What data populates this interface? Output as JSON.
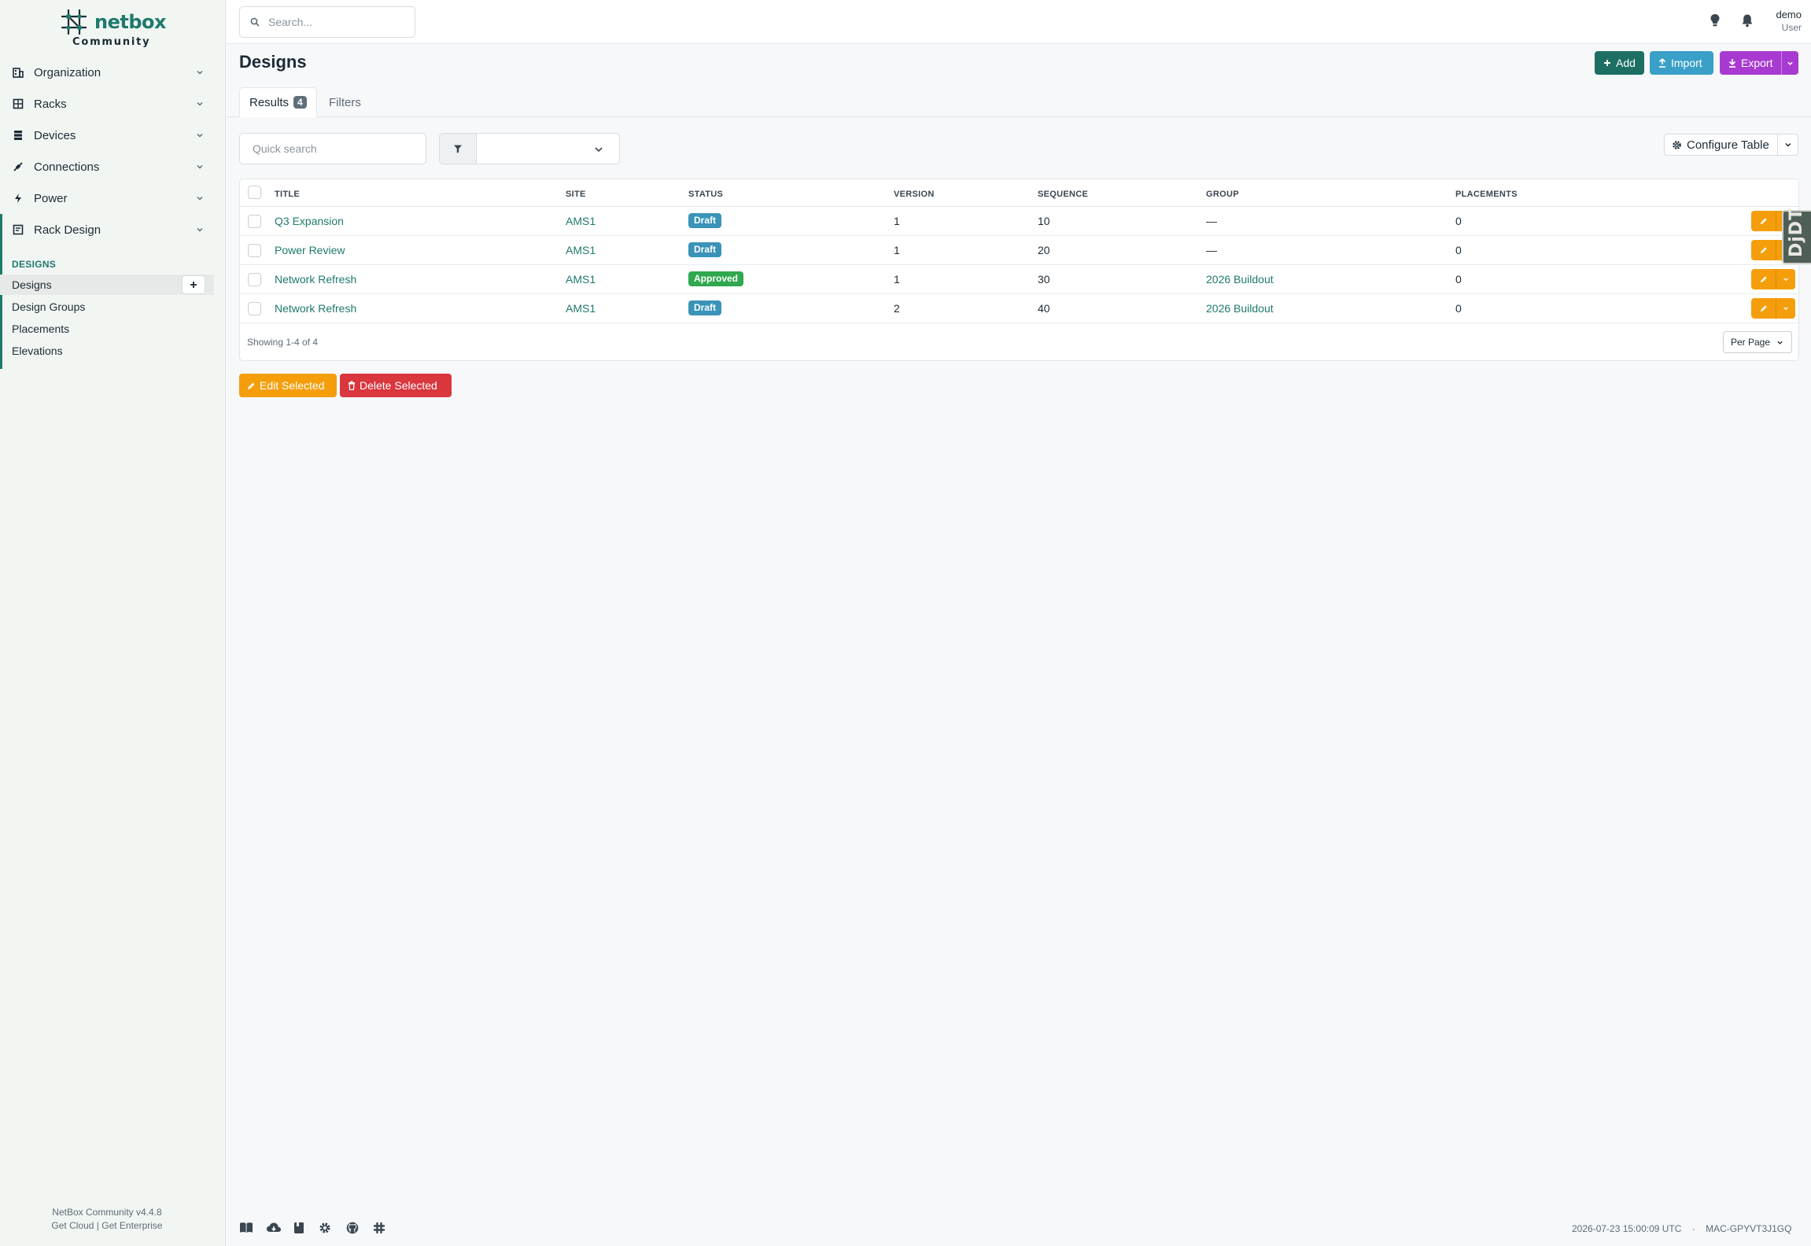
{
  "brand": {
    "name": "netbox",
    "edition": "Community"
  },
  "sidebar": {
    "groups": [
      {
        "label": "Organization",
        "icon": "organization-icon"
      },
      {
        "label": "Racks",
        "icon": "rack-icon"
      },
      {
        "label": "Devices",
        "icon": "devices-icon"
      },
      {
        "label": "Connections",
        "icon": "connections-icon"
      },
      {
        "label": "Power",
        "icon": "power-icon"
      },
      {
        "label": "Rack Design",
        "icon": "rack-design-icon"
      }
    ],
    "section_heading": "DESIGNS",
    "items": [
      {
        "label": "Designs",
        "active": true
      },
      {
        "label": "Design Groups"
      },
      {
        "label": "Placements"
      },
      {
        "label": "Elevations"
      }
    ],
    "footer": {
      "version": "NetBox Community v4.4.8",
      "cloud": "Get Cloud",
      "sep": "|",
      "enterprise": "Get Enterprise"
    }
  },
  "topbar": {
    "search_placeholder": "Search...",
    "user": {
      "name": "demo",
      "role": "User"
    }
  },
  "page": {
    "title": "Designs",
    "buttons": {
      "add": "Add",
      "import": "Import",
      "export": "Export"
    },
    "tabs": {
      "results": "Results",
      "results_count": "4",
      "filters": "Filters"
    },
    "quick_search_placeholder": "Quick search",
    "configure_table": "Configure Table"
  },
  "table": {
    "columns": [
      "TITLE",
      "SITE",
      "STATUS",
      "VERSION",
      "SEQUENCE",
      "GROUP",
      "PLACEMENTS"
    ],
    "rows": [
      {
        "title": "Q3 Expansion",
        "site": "AMS1",
        "status": "Draft",
        "version": "1",
        "sequence": "10",
        "group": "—",
        "placements": "0"
      },
      {
        "title": "Power Review",
        "site": "AMS1",
        "status": "Draft",
        "version": "1",
        "sequence": "20",
        "group": "—",
        "placements": "0"
      },
      {
        "title": "Network Refresh",
        "site": "AMS1",
        "status": "Approved",
        "version": "1",
        "sequence": "30",
        "group": "2026 Buildout",
        "placements": "0"
      },
      {
        "title": "Network Refresh",
        "site": "AMS1",
        "status": "Draft",
        "version": "2",
        "sequence": "40",
        "group": "2026 Buildout",
        "placements": "0"
      }
    ],
    "showing": "Showing 1-4 of 4",
    "per_page": "Per Page"
  },
  "bulk": {
    "edit": "Edit Selected",
    "delete": "Delete Selected"
  },
  "djdt_label": "DjDT",
  "footer": {
    "timestamp": "2026-07-23 15:00:09 UTC",
    "sep": "·",
    "host": "MAC-GPYVT3J1GQ"
  },
  "colors": {
    "brand": "#1f7a6c",
    "draft": "#3a93b8",
    "approved": "#2fa84f",
    "edit": "#f59e0b",
    "delete": "#d9363e",
    "export": "#a93ad1",
    "import": "#3aa0c7"
  }
}
